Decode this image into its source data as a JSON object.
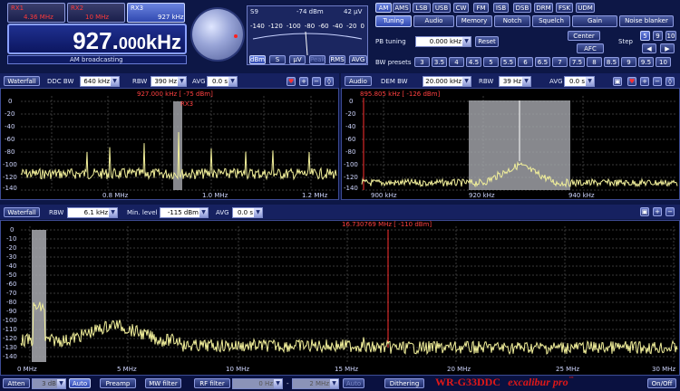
{
  "top": {
    "rx1": {
      "name": "RX1",
      "freq": "4.36 MHz"
    },
    "rx2": {
      "name": "RX2",
      "freq": "10 MHz"
    },
    "rx3": {
      "name": "RX3",
      "freq": "927 kHz"
    },
    "freq_main": "927.",
    "freq_small": "000",
    "freq_unit": "kHz",
    "mode_desc": "AM broadcasting"
  },
  "smeter": {
    "s_label": "S9",
    "dbm_value": "-74 dBm",
    "uv_value": "42 µV",
    "scale": [
      "-140",
      "-120",
      "-100",
      "-80",
      "-60",
      "-40",
      "-20",
      "0"
    ],
    "buttons": [
      "dBm",
      "S",
      "µV",
      "Peak",
      "RMS",
      "AVG"
    ]
  },
  "modes": [
    "AM",
    "AMS",
    "LSB",
    "USB",
    "CW",
    "FM",
    "ISB",
    "DSB",
    "DRM",
    "FSK",
    "UDM"
  ],
  "tabs": [
    "Tuning",
    "Audio",
    "Memory",
    "Notch",
    "Squelch",
    "Gain",
    "Noise blanker"
  ],
  "tuning": {
    "pb_label": "PB tuning",
    "pb_value": "0.000 kHz",
    "reset": "Reset",
    "center": "Center",
    "afc": "AFC",
    "step": "Step",
    "step_values": [
      "5",
      "9",
      "10"
    ],
    "bw_label": "BW presets",
    "bw_values": [
      "3",
      "3.5",
      "4",
      "4.5",
      "5",
      "5.5",
      "6",
      "6.5",
      "7",
      "7.5",
      "8",
      "8.5",
      "9",
      "9.5",
      "10"
    ]
  },
  "ddc": {
    "waterfall": "Waterfall",
    "ddc_bw_label": "DDC BW",
    "ddc_bw": "640 kHz",
    "rbw_label": "RBW",
    "rbw": "390 Hz",
    "avg_label": "AVG",
    "avg": "0.0 s",
    "marker": "927.000 kHz [ -75 dBm]",
    "rx_tag": "RX3",
    "xticks": [
      "0.8 MHz",
      "1.0 MHz",
      "1.2 MHz"
    ],
    "yticks": [
      "0",
      "-20",
      "-40",
      "-60",
      "-80",
      "-100",
      "-120",
      "-140"
    ]
  },
  "dem": {
    "audio": "Audio",
    "dem_bw_label": "DEM BW",
    "dem_bw": "20.000 kHz",
    "rbw_label": "RBW",
    "rbw": "39 Hz",
    "avg_label": "AVG",
    "avg": "0.0 s",
    "marker": "895.805 kHz [ -126 dBm]",
    "xticks": [
      "900 kHz",
      "920 kHz",
      "940 kHz"
    ],
    "yticks": [
      "0",
      "-20",
      "-40",
      "-60",
      "-80",
      "-100",
      "-120",
      "-140"
    ]
  },
  "wide": {
    "waterfall": "Waterfall",
    "rbw_label": "RBW",
    "rbw": "6.1 kHz",
    "min_label": "Min. level",
    "min_level": "-115 dBm",
    "avg_label": "AVG",
    "avg": "0.0 s",
    "marker": "16.730769 MHz [ -110 dBm]",
    "xticks": [
      "0 MHz",
      "5 MHz",
      "10 MHz",
      "15 MHz",
      "20 MHz",
      "25 MHz",
      "30 MHz"
    ],
    "yticks": [
      "0",
      "-10",
      "-20",
      "-30",
      "-40",
      "-50",
      "-60",
      "-70",
      "-80",
      "-90",
      "-100",
      "-110",
      "-120",
      "-130",
      "-140"
    ]
  },
  "bottom": {
    "atten": "Atten",
    "atten_val": "3 dB",
    "auto1": "Auto",
    "preamp": "Preamp",
    "mw": "MW filter",
    "rf": "RF filter",
    "rf_from": "0 Hz",
    "rf_to": "2 MHz",
    "auto2": "Auto",
    "dither": "Dithering",
    "brand": "WR-G33DDC",
    "brand2": "excalibur pro",
    "tm": "™",
    "onoff": "On/Off"
  },
  "colors": {
    "spectrum": "#f1ef9a",
    "marker": "#ff3030",
    "band": "#a9aab0"
  }
}
